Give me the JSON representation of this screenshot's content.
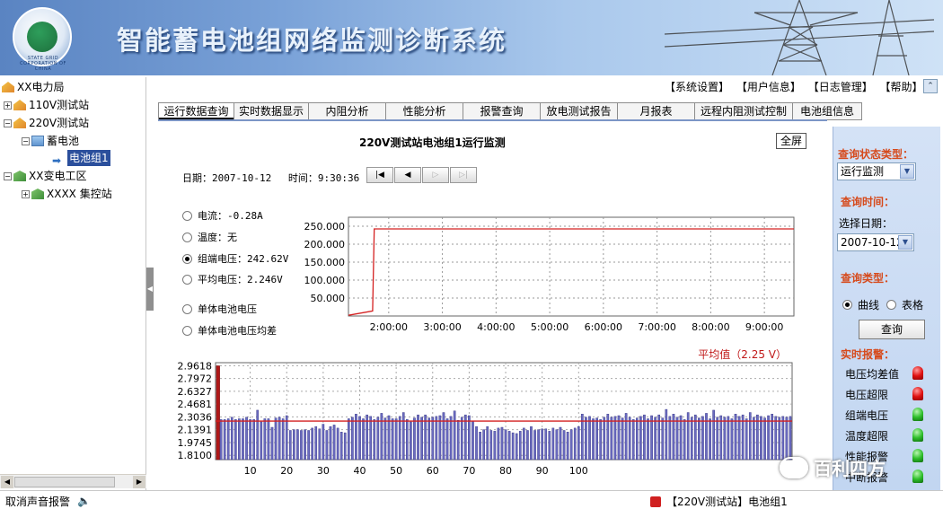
{
  "app": {
    "title": "智能蓄电池组网络监测诊断系统",
    "logo_text": "STATE GRID CORPORATION OF CHINA"
  },
  "top_links": [
    "【系统设置】",
    "【用户信息】",
    "【日志管理】",
    "【帮助】"
  ],
  "tree": {
    "root": "XX电力局",
    "station1": "110V测试站",
    "station2": "220V测试站",
    "battery_group": "蓄电池",
    "battery_selected": "电池组1",
    "substation": "XX变电工区",
    "control_station": "XXXX 集控站"
  },
  "tabs": [
    "运行数据查询",
    "实时数据显示",
    "内阻分析",
    "性能分析",
    "报警查询",
    "放电测试报告",
    "月报表",
    "远程内阻测试控制",
    "电池组信息"
  ],
  "main": {
    "title": "220V测试站电池组1运行监测",
    "fullscreen_label": "全屏",
    "date_label": "日期：2007-10-12",
    "time_label": "时间：9:30:36",
    "nav_first": "|◀",
    "nav_prev": "◀",
    "nav_next": "▷",
    "nav_last": "▷|"
  },
  "radios": [
    {
      "label": "电流：-0.28A",
      "selected": false
    },
    {
      "label": "温度：无",
      "selected": false
    },
    {
      "label": "组端电压：242.62V",
      "selected": true
    },
    {
      "label": "平均电压：2.246V",
      "selected": false
    },
    {
      "label": "单体电池电压",
      "selected": false
    },
    {
      "label": "单体电池电压均差",
      "selected": false
    }
  ],
  "right_panel": {
    "query_status_label": "查询状态类型：",
    "query_status_value": "运行监测",
    "query_time_label": "查询时间：",
    "select_date_label": "选择日期：",
    "select_date_value": "2007-10-12",
    "query_type_label": "查询类型：",
    "option_curve": "曲线",
    "option_table": "表格",
    "query_button": "查询",
    "realtime_alarm_label": "实时报警：",
    "alarms": [
      {
        "label": "电压均差值",
        "status": "red"
      },
      {
        "label": "电压超限",
        "status": "red"
      },
      {
        "label": "组端电压",
        "status": "green"
      },
      {
        "label": "温度超限",
        "status": "green"
      },
      {
        "label": "性能报警",
        "status": "green"
      },
      {
        "label": "中断报警",
        "status": "green"
      }
    ]
  },
  "status_bar": {
    "left_text": "取消声音报警",
    "right_text": "【220V测试站】电池组1"
  },
  "watermark": "百利四方",
  "colors": {
    "banner_dark": "#5a84c2",
    "panel_bg": "#c8daf3",
    "alarm_red": "#e01212",
    "alarm_green": "#2ebf2b",
    "line_red": "#d42020",
    "bar_fill": "#6b6bc0"
  },
  "chart_data": [
    {
      "type": "line",
      "title": "",
      "x_ticks": [
        "2:00:00",
        "3:00:00",
        "4:00:00",
        "5:00:00",
        "6:00:00",
        "7:00:00",
        "8:00:00",
        "9:00:00"
      ],
      "y_ticks": [
        "250.000",
        "200.000",
        "150.000",
        "100.000",
        "50.000"
      ],
      "ylim": [
        0,
        275
      ],
      "xlim_hours": [
        1.25,
        9.55
      ],
      "points": [
        [
          1.25,
          2
        ],
        [
          1.7,
          14
        ],
        [
          1.73,
          242.6
        ],
        [
          9.55,
          242.6
        ]
      ],
      "grid": true
    },
    {
      "type": "bar",
      "annotation": "平均值（2.25 V）",
      "average": 2.25,
      "ylim": [
        1.755,
        3.0
      ],
      "y_ticks": [
        "2.9618",
        "2.7972",
        "2.6327",
        "2.4681",
        "2.3036",
        "2.1391",
        "1.9745",
        "1.8100"
      ],
      "x_ticks": [
        "10",
        "20",
        "30",
        "40",
        "50",
        "60",
        "70",
        "80",
        "90",
        "100"
      ],
      "grid": true,
      "values": [
        2.96,
        2.27,
        2.27,
        2.28,
        2.3,
        2.27,
        2.28,
        2.28,
        2.3,
        2.27,
        2.27,
        2.39,
        2.24,
        2.28,
        2.28,
        2.17,
        2.29,
        2.3,
        2.28,
        2.32,
        2.13,
        2.14,
        2.14,
        2.13,
        2.14,
        2.13,
        2.16,
        2.18,
        2.15,
        2.21,
        2.13,
        2.18,
        2.2,
        2.16,
        2.11,
        2.1,
        2.28,
        2.3,
        2.34,
        2.31,
        2.28,
        2.33,
        2.31,
        2.27,
        2.3,
        2.35,
        2.29,
        2.32,
        2.28,
        2.28,
        2.31,
        2.36,
        2.27,
        2.24,
        2.29,
        2.33,
        2.3,
        2.33,
        2.29,
        2.3,
        2.31,
        2.32,
        2.36,
        2.28,
        2.31,
        2.38,
        2.26,
        2.3,
        2.33,
        2.32,
        2.25,
        2.18,
        2.11,
        2.14,
        2.18,
        2.13,
        2.12,
        2.16,
        2.17,
        2.14,
        2.12,
        2.1,
        2.09,
        2.12,
        2.16,
        2.13,
        2.18,
        2.13,
        2.14,
        2.15,
        2.15,
        2.12,
        2.16,
        2.14,
        2.17,
        2.13,
        2.11,
        2.14,
        2.16,
        2.18,
        2.34,
        2.3,
        2.31,
        2.28,
        2.29,
        2.27,
        2.3,
        2.34,
        2.3,
        2.31,
        2.32,
        2.29,
        2.35,
        2.3,
        2.27,
        2.29,
        2.31,
        2.33,
        2.28,
        2.32,
        2.3,
        2.33,
        2.29,
        2.4,
        2.31,
        2.34,
        2.3,
        2.32,
        2.27,
        2.36,
        2.3,
        2.33,
        2.29,
        2.31,
        2.35,
        2.28,
        2.39,
        2.3,
        2.32,
        2.3,
        2.31,
        2.28,
        2.34,
        2.31,
        2.33,
        2.28,
        2.36,
        2.3,
        2.33,
        2.31,
        2.29,
        2.32,
        2.34,
        2.31,
        2.3,
        2.31,
        2.3,
        2.31
      ]
    }
  ]
}
